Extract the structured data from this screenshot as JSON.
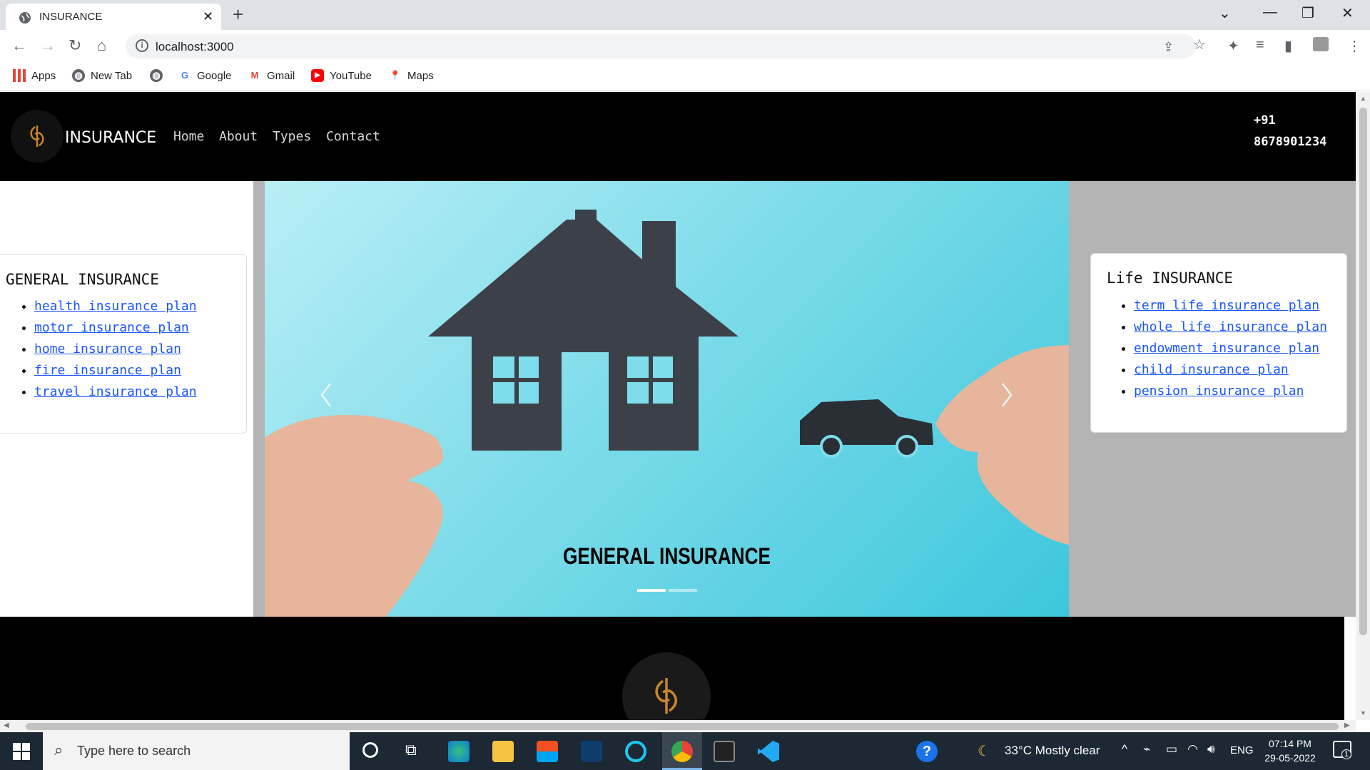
{
  "browser": {
    "tab_title": "INSURANCE",
    "url": "localhost:3000",
    "bookmarks": [
      "Apps",
      "New Tab",
      "Google",
      "Gmail",
      "YouTube",
      "Maps"
    ]
  },
  "header": {
    "brand": "INSURANCE",
    "nav": [
      "Home",
      "About",
      "Types",
      "Contact"
    ],
    "phone_line1": "+91",
    "phone_line2": "8678901234"
  },
  "left_card": {
    "title": "GENERAL INSURANCE",
    "links": [
      "health insurance plan",
      "motor insurance plan",
      "home insurance plan",
      "fire insurance plan",
      "travel insurance plan"
    ]
  },
  "right_card": {
    "title": "Life INSURANCE",
    "links": [
      "term life insurance plan",
      "whole life insurance plan",
      "endowment insurance plan",
      "child insurance plan",
      "pension insurance plan"
    ]
  },
  "carousel": {
    "caption": "GENERAL INSURANCE",
    "indicator_count": 2,
    "active_index": 0
  },
  "taskbar": {
    "search_placeholder": "Type here to search",
    "weather": "33°C  Mostly clear",
    "lang": "ENG",
    "time": "07:14 PM",
    "date": "29-05-2022",
    "notif_count": "1"
  },
  "colors": {
    "header_bg": "#000000",
    "link": "#1a56ff",
    "hero_bg": "#7fdcea",
    "logo_accent": "#c8862a"
  }
}
